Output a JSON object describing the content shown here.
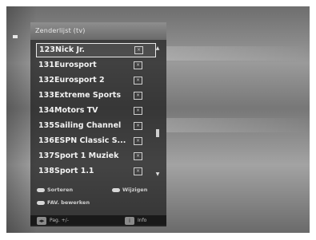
{
  "panel": {
    "title": "Zenderlijst (tv)"
  },
  "channels": [
    {
      "number": "123",
      "name": "Nick Jr.",
      "box": "×"
    },
    {
      "number": "131",
      "name": "Eurosport",
      "box": "×"
    },
    {
      "number": "132",
      "name": "Eurosport 2",
      "box": "×"
    },
    {
      "number": "133",
      "name": "Extreme Sports",
      "box": "×"
    },
    {
      "number": "134",
      "name": "Motors TV",
      "box": "×"
    },
    {
      "number": "135",
      "name": "Sailing Channel",
      "box": "×"
    },
    {
      "number": "136",
      "name": "ESPN Classic S...",
      "box": "×"
    },
    {
      "number": "137",
      "name": "Sport 1 Muziek",
      "box": "×"
    },
    {
      "number": "138",
      "name": "Sport 1.1",
      "box": "×"
    }
  ],
  "legend": {
    "sort_label": "Sorteren",
    "favorites_label": "Wijzigen",
    "fav_edit_label": "FAV. bewerken"
  },
  "bottom_bar": {
    "left_label": "Pag. +/-",
    "right_label": "Info"
  }
}
